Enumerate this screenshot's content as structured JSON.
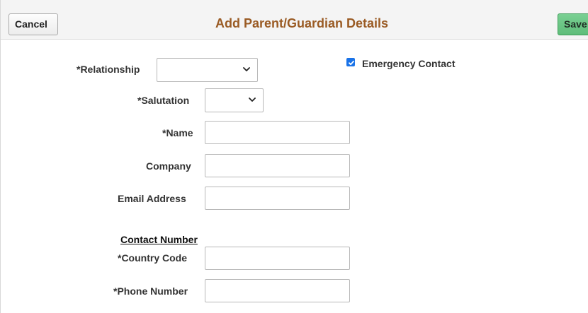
{
  "header": {
    "cancel_label": "Cancel",
    "title": "Add Parent/Guardian Details",
    "save_label": "Save"
  },
  "form": {
    "relationship": {
      "label": "*Relationship",
      "value": ""
    },
    "emergency_contact": {
      "label": "Emergency Contact",
      "checked": true
    },
    "salutation": {
      "label": "*Salutation",
      "value": ""
    },
    "name": {
      "label": "*Name",
      "value": "",
      "placeholder": ""
    },
    "company": {
      "label": "Company",
      "value": "",
      "placeholder": ""
    },
    "email": {
      "label": "Email Address",
      "value": "",
      "placeholder": ""
    },
    "contact_number": {
      "section_heading": "Contact Number",
      "country_code": {
        "label": "*Country Code",
        "value": "",
        "placeholder": ""
      },
      "phone_number": {
        "label": "*Phone Number",
        "value": "",
        "placeholder": ""
      }
    }
  },
  "icons": {
    "dropdown": "chevron-down-icon",
    "checkbox": "checkmark-icon"
  },
  "colors": {
    "title": "#9a5b24",
    "save_button": "#6cc586",
    "checkbox": "#1a73e8"
  }
}
